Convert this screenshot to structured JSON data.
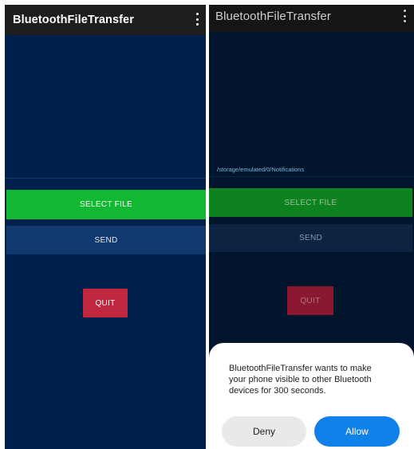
{
  "left_screen": {
    "appbar": {
      "title": "BluetoothFileTransfer",
      "menu_icon": "more-vert-icon"
    },
    "buttons": {
      "select_file": "SELECT FILE",
      "send": "SEND",
      "quit": "QUIT"
    }
  },
  "right_screen": {
    "appbar": {
      "title": "BluetoothFileTransfer",
      "menu_icon": "more-vert-icon"
    },
    "file_path": "/storage/emulated/0/Notifications",
    "buttons": {
      "select_file": "SELECT FILE",
      "send": "SEND",
      "quit": "QUIT"
    },
    "dialog": {
      "message": "BluetoothFileTransfer wants to make your phone visible to other Bluetooth devices for 300 seconds.",
      "deny": "Deny",
      "allow": "Allow"
    }
  },
  "colors": {
    "background": "#00204c",
    "appbar": "#1e1e1e",
    "select_button": "#13b832",
    "send_button": "#10396d",
    "quit_button": "#c0273f",
    "allow_button": "#1181ea"
  }
}
